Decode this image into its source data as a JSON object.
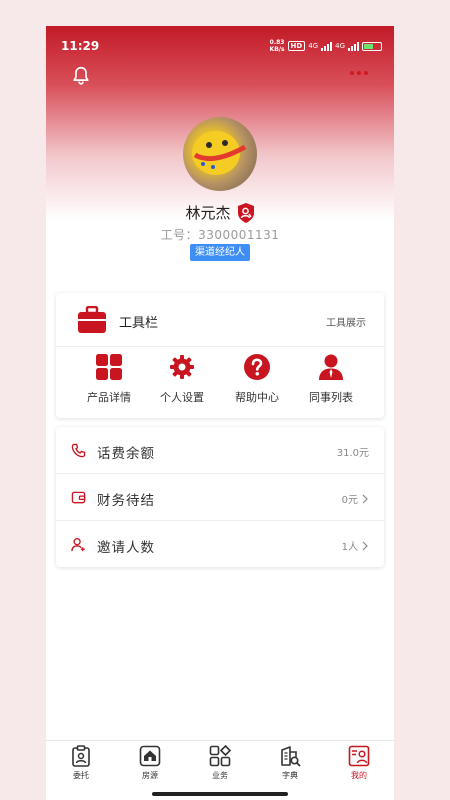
{
  "status_bar": {
    "time": "11:29",
    "speed_value": "0.83",
    "speed_unit": "KB/s",
    "hd": "HD",
    "net1": "4G",
    "net2": "4G"
  },
  "header": {
    "bell_icon": "bell-icon",
    "more_icon": "more-dots-icon"
  },
  "profile": {
    "name": "林元杰",
    "staff_id": "工号：3300001131",
    "role": "渠道经纪人"
  },
  "toolbox": {
    "title": "工具栏",
    "link": "工具展示",
    "items": [
      {
        "label": "产品详情",
        "icon": "grid-icon"
      },
      {
        "label": "个人设置",
        "icon": "gear-icon"
      },
      {
        "label": "帮助中心",
        "icon": "help-icon"
      },
      {
        "label": "同事列表",
        "icon": "user-icon"
      }
    ]
  },
  "list": [
    {
      "label": "话费余额",
      "value": "31.0元",
      "icon": "phone-icon"
    },
    {
      "label": "财务待结",
      "value": "0元",
      "icon": "wallet-icon"
    },
    {
      "label": "邀请人数",
      "value": "1人",
      "icon": "add-user-icon"
    }
  ],
  "tabs": [
    {
      "label": "委托",
      "icon": "commission-icon"
    },
    {
      "label": "房源",
      "icon": "house-icon"
    },
    {
      "label": "业务",
      "icon": "business-icon"
    },
    {
      "label": "字典",
      "icon": "dictionary-icon"
    },
    {
      "label": "我的",
      "icon": "profile-icon"
    }
  ],
  "colors": {
    "accent": "#c8151f",
    "role_badge": "#3f8ef5"
  }
}
